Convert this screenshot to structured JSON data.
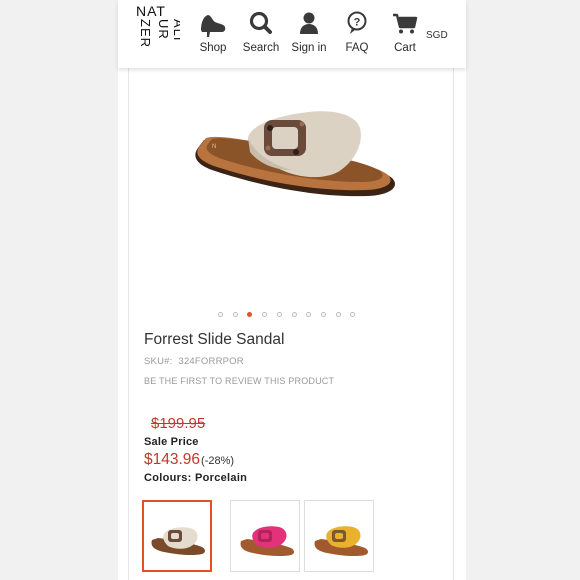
{
  "header": {
    "logo_text": "NATURALIZER",
    "logo_col1": "NATUR",
    "logo_col2": "ALIZER",
    "nav": [
      {
        "label": "Shop",
        "icon": "shoe-icon"
      },
      {
        "label": "Search",
        "icon": "search-icon"
      },
      {
        "label": "Sign in",
        "icon": "user-icon"
      },
      {
        "label": "FAQ",
        "icon": "help-bubble-icon"
      },
      {
        "label": "Cart",
        "icon": "cart-icon"
      }
    ],
    "currency": "SGD"
  },
  "gallery": {
    "image_count": 10,
    "active_index": 2
  },
  "product": {
    "title": "Forrest Slide Sandal",
    "sku_label": "SKU#:",
    "sku_value": "324FORRPOR",
    "review_link": "BE THE FIRST TO REVIEW THIS PRODUCT",
    "original_price": "$199.95",
    "sale_label": "Sale Price",
    "sale_price": "$143.96",
    "discount": "(-28%)",
    "colours_line": "Colours: Porcelain"
  },
  "swatches": [
    {
      "name": "Porcelain",
      "color": "#e4dccf",
      "selected": true
    },
    {
      "name": "Pink",
      "color": "#e2337a",
      "selected": false
    },
    {
      "name": "Yellow",
      "color": "#e9b12c",
      "selected": false
    }
  ],
  "colors": {
    "accent": "#e0522a",
    "price_red": "#c0392b"
  }
}
